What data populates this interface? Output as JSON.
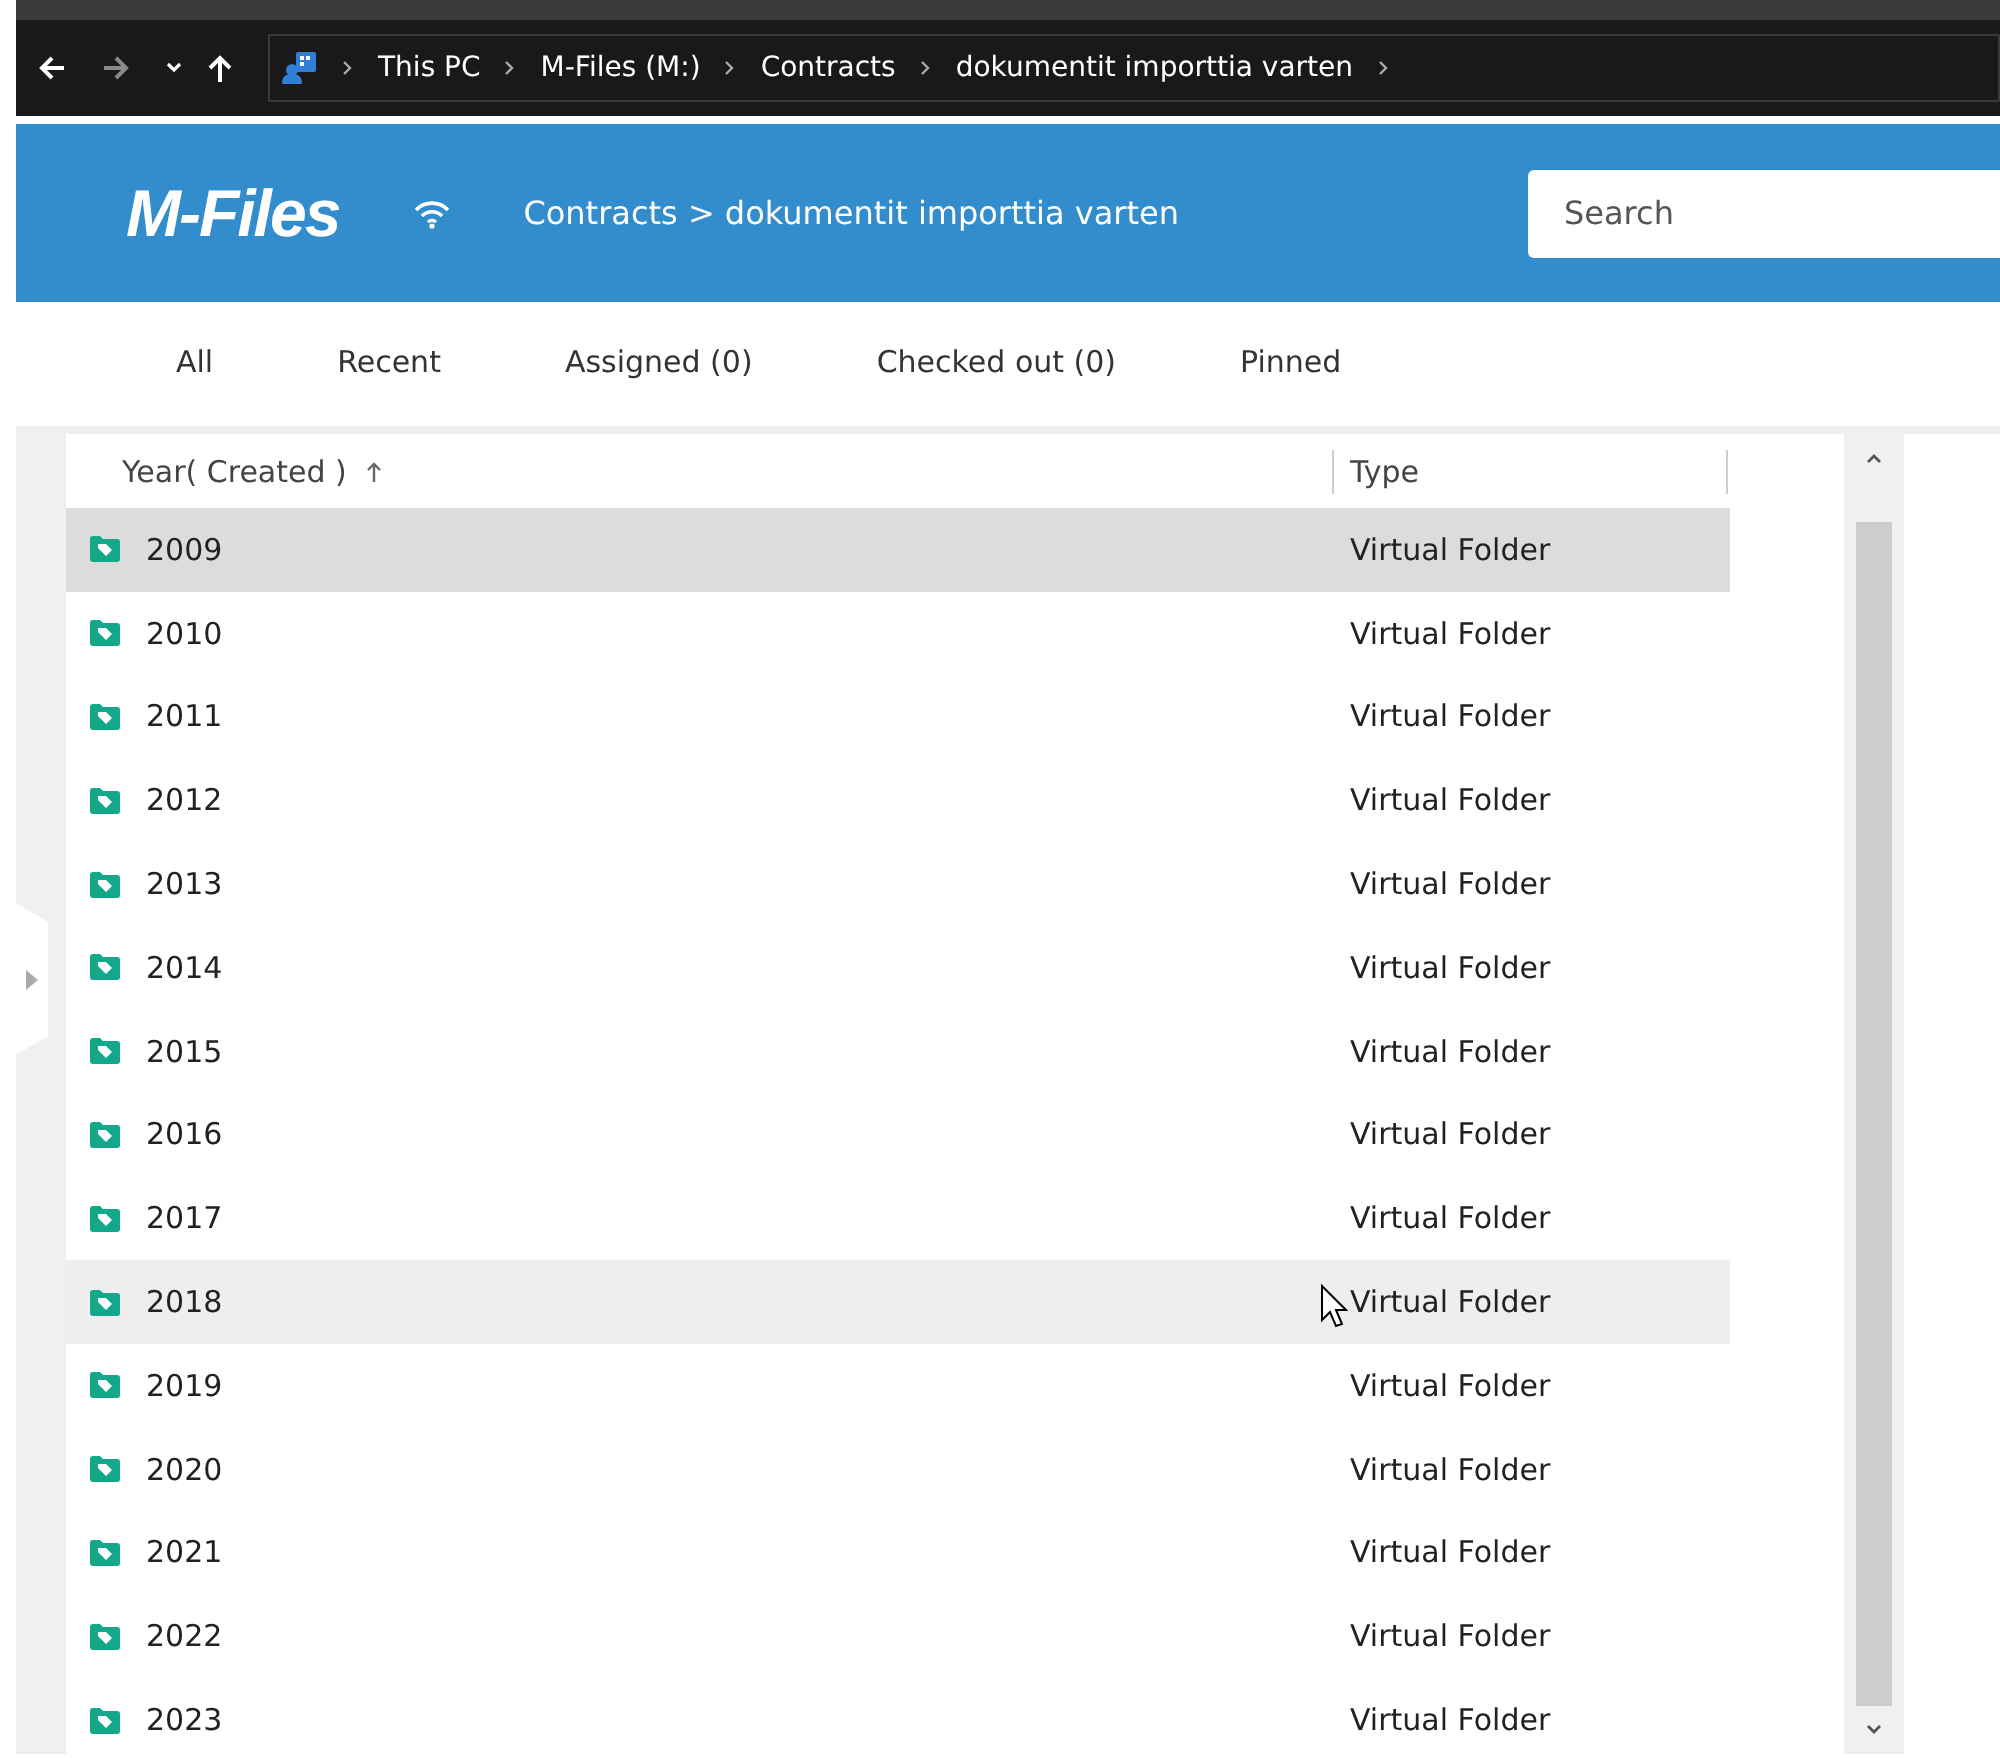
{
  "address_bar": {
    "path": [
      "This PC",
      "M-Files (M:)",
      "Contracts",
      "dokumentit importtia varten"
    ]
  },
  "header": {
    "logo": "M-Files",
    "breadcrumb": "Contracts > dokumentit importtia varten",
    "search": {
      "placeholder": "Search"
    }
  },
  "tabs": [
    {
      "label": "All",
      "selected": false
    },
    {
      "label": "Recent",
      "selected": false
    },
    {
      "label": "Assigned (0)",
      "selected": false
    },
    {
      "label": "Checked out (0)",
      "selected": false
    },
    {
      "label": "Pinned",
      "selected": false
    }
  ],
  "table": {
    "columns": [
      {
        "label": "Year( Created )",
        "sorted": true
      },
      {
        "label": "Type",
        "sorted": false
      }
    ],
    "rows": [
      {
        "name": "2009",
        "type": "Virtual Folder",
        "selected": true,
        "hovered": false
      },
      {
        "name": "2010",
        "type": "Virtual Folder",
        "selected": false,
        "hovered": false
      },
      {
        "name": "2011",
        "type": "Virtual Folder",
        "selected": false,
        "hovered": false
      },
      {
        "name": "2012",
        "type": "Virtual Folder",
        "selected": false,
        "hovered": false
      },
      {
        "name": "2013",
        "type": "Virtual Folder",
        "selected": false,
        "hovered": false
      },
      {
        "name": "2014",
        "type": "Virtual Folder",
        "selected": false,
        "hovered": false
      },
      {
        "name": "2015",
        "type": "Virtual Folder",
        "selected": false,
        "hovered": false
      },
      {
        "name": "2016",
        "type": "Virtual Folder",
        "selected": false,
        "hovered": false
      },
      {
        "name": "2017",
        "type": "Virtual Folder",
        "selected": false,
        "hovered": false
      },
      {
        "name": "2018",
        "type": "Virtual Folder",
        "selected": false,
        "hovered": true
      },
      {
        "name": "2019",
        "type": "Virtual Folder",
        "selected": false,
        "hovered": false
      },
      {
        "name": "2020",
        "type": "Virtual Folder",
        "selected": false,
        "hovered": false
      },
      {
        "name": "2021",
        "type": "Virtual Folder",
        "selected": false,
        "hovered": false
      },
      {
        "name": "2022",
        "type": "Virtual Folder",
        "selected": false,
        "hovered": false
      },
      {
        "name": "2023",
        "type": "Virtual Folder",
        "selected": false,
        "hovered": false
      }
    ]
  }
}
